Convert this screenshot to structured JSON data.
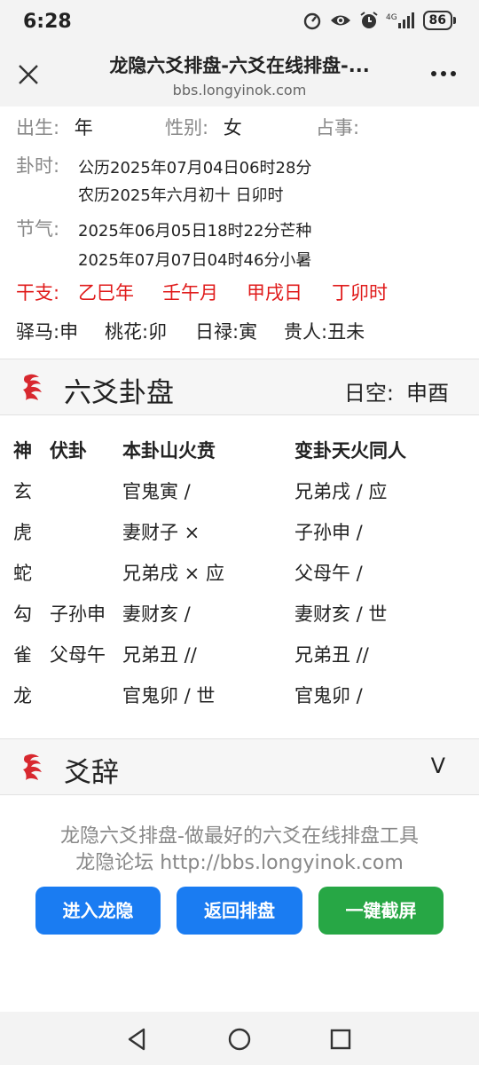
{
  "status": {
    "time": "6:28",
    "battery": "86"
  },
  "browser": {
    "title": "龙隐六爻排盘-六爻在线排盘-...",
    "url": "bbs.longyinok.com"
  },
  "info": {
    "birth_label": "出生:",
    "birth_value": "年",
    "gender_label": "性别:",
    "gender_value": "女",
    "matter_label": "占事:",
    "time_label": "卦时:",
    "time_line1": "公历2025年07月04日06时28分",
    "time_line2": "农历2025年六月初十 日卯时",
    "solar_label": "节气:",
    "solar_line1": "2025年06月05日18时22分芒种",
    "solar_line2": "2025年07月07日04时46分小暑",
    "ganzhi_label": "干支:",
    "ganzhi": [
      "乙巳年",
      "壬午月",
      "甲戌日",
      "丁卯时"
    ],
    "extras": [
      "驿马:申",
      "桃花:卯",
      "日禄:寅",
      "贵人:丑未"
    ]
  },
  "pan": {
    "title": "六爻卦盘",
    "void_label": "日空:",
    "void_value": "申酉",
    "headers": [
      "神",
      "伏卦",
      "本卦山火贲",
      "变卦天火同人"
    ],
    "rows": [
      {
        "god": "玄",
        "fu": "",
        "ben": "官鬼寅 /",
        "bian": "兄弟戌 / 应"
      },
      {
        "god": "虎",
        "fu": "",
        "ben": "妻财子 ×",
        "bian": "子孙申 /"
      },
      {
        "god": "蛇",
        "fu": "",
        "ben": "兄弟戌 × 应",
        "bian": "父母午 /"
      },
      {
        "god": "勾",
        "fu": "子孙申",
        "ben": "妻财亥 /",
        "bian": "妻财亥 / 世"
      },
      {
        "god": "雀",
        "fu": "父母午",
        "ben": "兄弟丑 //",
        "bian": "兄弟丑 //"
      },
      {
        "god": "龙",
        "fu": "",
        "ben": "官鬼卯 / 世",
        "bian": "官鬼卯 /"
      }
    ]
  },
  "yaoci": {
    "title": "爻辞",
    "chevron": "V"
  },
  "footer": {
    "line1": "龙隐六爻排盘-做最好的六爻在线排盘工具",
    "line2": "龙隐论坛 http://bbs.longyinok.com",
    "btn_enter": "进入龙隐",
    "btn_back": "返回排盘",
    "btn_shot": "一键截屏"
  },
  "colors": {
    "accent_blue": "#1a7cf2",
    "accent_green": "#27a745",
    "ganzhi_red": "#e01b1b",
    "logo_red": "#d8282f"
  }
}
